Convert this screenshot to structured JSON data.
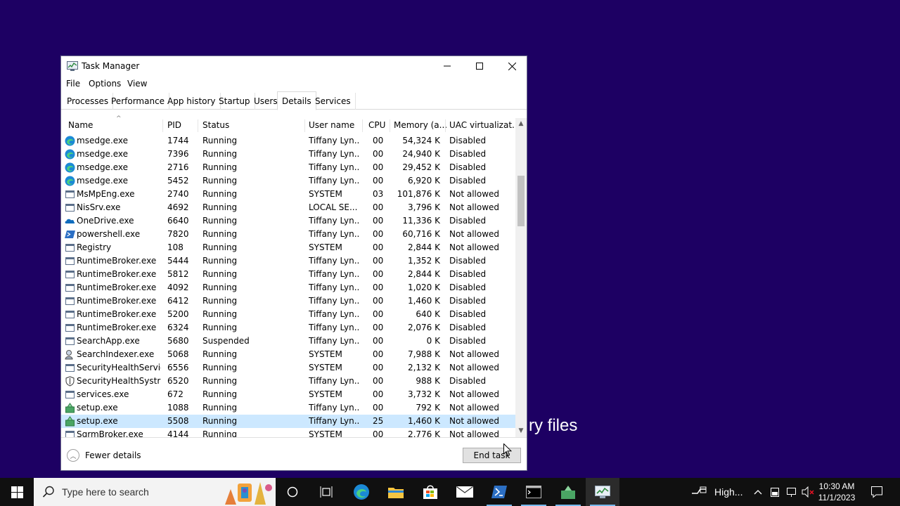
{
  "background": {
    "text": "ry files",
    "color": "#1d0063"
  },
  "window": {
    "title": "Task Manager",
    "menu": [
      "File",
      "Options",
      "View"
    ],
    "tabs": [
      "Processes",
      "Performance",
      "App history",
      "Startup",
      "Users",
      "Details",
      "Services"
    ],
    "active_tab": "Details",
    "columns": [
      "Name",
      "PID",
      "Status",
      "User name",
      "CPU",
      "Memory (a...",
      "UAC virtualizat..."
    ],
    "rows": [
      {
        "icon": "edge-icon",
        "name": "msedge.exe",
        "pid": "1744",
        "status": "Running",
        "user": "Tiffany Lyn...",
        "cpu": "00",
        "mem": "54,324 K",
        "uac": "Disabled"
      },
      {
        "icon": "edge-icon",
        "name": "msedge.exe",
        "pid": "7396",
        "status": "Running",
        "user": "Tiffany Lyn...",
        "cpu": "00",
        "mem": "24,940 K",
        "uac": "Disabled"
      },
      {
        "icon": "edge-icon",
        "name": "msedge.exe",
        "pid": "2716",
        "status": "Running",
        "user": "Tiffany Lyn...",
        "cpu": "00",
        "mem": "29,452 K",
        "uac": "Disabled"
      },
      {
        "icon": "edge-icon",
        "name": "msedge.exe",
        "pid": "5452",
        "status": "Running",
        "user": "Tiffany Lyn...",
        "cpu": "00",
        "mem": "6,920 K",
        "uac": "Disabled"
      },
      {
        "icon": "process-icon",
        "name": "MsMpEng.exe",
        "pid": "2740",
        "status": "Running",
        "user": "SYSTEM",
        "cpu": "03",
        "mem": "101,876 K",
        "uac": "Not allowed"
      },
      {
        "icon": "process-icon",
        "name": "NisSrv.exe",
        "pid": "4692",
        "status": "Running",
        "user": "LOCAL SE...",
        "cpu": "00",
        "mem": "3,796 K",
        "uac": "Not allowed"
      },
      {
        "icon": "onedrive-icon",
        "name": "OneDrive.exe",
        "pid": "6640",
        "status": "Running",
        "user": "Tiffany Lyn...",
        "cpu": "00",
        "mem": "11,336 K",
        "uac": "Disabled"
      },
      {
        "icon": "powershell-icon",
        "name": "powershell.exe",
        "pid": "7820",
        "status": "Running",
        "user": "Tiffany Lyn...",
        "cpu": "00",
        "mem": "60,716 K",
        "uac": "Not allowed"
      },
      {
        "icon": "process-icon",
        "name": "Registry",
        "pid": "108",
        "status": "Running",
        "user": "SYSTEM",
        "cpu": "00",
        "mem": "2,844 K",
        "uac": "Not allowed"
      },
      {
        "icon": "process-icon",
        "name": "RuntimeBroker.exe",
        "pid": "5444",
        "status": "Running",
        "user": "Tiffany Lyn...",
        "cpu": "00",
        "mem": "1,352 K",
        "uac": "Disabled"
      },
      {
        "icon": "process-icon",
        "name": "RuntimeBroker.exe",
        "pid": "5812",
        "status": "Running",
        "user": "Tiffany Lyn...",
        "cpu": "00",
        "mem": "2,844 K",
        "uac": "Disabled"
      },
      {
        "icon": "process-icon",
        "name": "RuntimeBroker.exe",
        "pid": "4092",
        "status": "Running",
        "user": "Tiffany Lyn...",
        "cpu": "00",
        "mem": "1,020 K",
        "uac": "Disabled"
      },
      {
        "icon": "process-icon",
        "name": "RuntimeBroker.exe",
        "pid": "6412",
        "status": "Running",
        "user": "Tiffany Lyn...",
        "cpu": "00",
        "mem": "1,460 K",
        "uac": "Disabled"
      },
      {
        "icon": "process-icon",
        "name": "RuntimeBroker.exe",
        "pid": "5200",
        "status": "Running",
        "user": "Tiffany Lyn...",
        "cpu": "00",
        "mem": "640 K",
        "uac": "Disabled"
      },
      {
        "icon": "process-icon",
        "name": "RuntimeBroker.exe",
        "pid": "6324",
        "status": "Running",
        "user": "Tiffany Lyn...",
        "cpu": "00",
        "mem": "2,076 K",
        "uac": "Disabled"
      },
      {
        "icon": "process-icon",
        "name": "SearchApp.exe",
        "pid": "5680",
        "status": "Suspended",
        "user": "Tiffany Lyn...",
        "cpu": "00",
        "mem": "0 K",
        "uac": "Disabled"
      },
      {
        "icon": "search-indexer-icon",
        "name": "SearchIndexer.exe",
        "pid": "5068",
        "status": "Running",
        "user": "SYSTEM",
        "cpu": "00",
        "mem": "7,988 K",
        "uac": "Not allowed"
      },
      {
        "icon": "process-icon",
        "name": "SecurityHealthServic...",
        "pid": "6556",
        "status": "Running",
        "user": "SYSTEM",
        "cpu": "00",
        "mem": "2,132 K",
        "uac": "Not allowed"
      },
      {
        "icon": "shield-icon",
        "name": "SecurityHealthSystra...",
        "pid": "6520",
        "status": "Running",
        "user": "Tiffany Lyn...",
        "cpu": "00",
        "mem": "988 K",
        "uac": "Disabled"
      },
      {
        "icon": "process-icon",
        "name": "services.exe",
        "pid": "672",
        "status": "Running",
        "user": "SYSTEM",
        "cpu": "00",
        "mem": "3,732 K",
        "uac": "Not allowed"
      },
      {
        "icon": "setup-icon",
        "name": "setup.exe",
        "pid": "1088",
        "status": "Running",
        "user": "Tiffany Lyn...",
        "cpu": "00",
        "mem": "792 K",
        "uac": "Not allowed"
      },
      {
        "icon": "setup-icon",
        "name": "setup.exe",
        "pid": "5508",
        "status": "Running",
        "user": "Tiffany Lyn...",
        "cpu": "25",
        "mem": "1,460 K",
        "uac": "Not allowed",
        "selected": true
      },
      {
        "icon": "process-icon",
        "name": "SgrmBroker.exe",
        "pid": "4144",
        "status": "Running",
        "user": "SYSTEM",
        "cpu": "00",
        "mem": "2,776 K",
        "uac": "Not allowed"
      }
    ],
    "footer": {
      "fewer_details": "Fewer details",
      "end_task": "End task"
    }
  },
  "taskbar": {
    "search_placeholder": "Type here to search",
    "tray_text": "High...",
    "time": "10:30 AM",
    "date": "11/1/2023"
  }
}
